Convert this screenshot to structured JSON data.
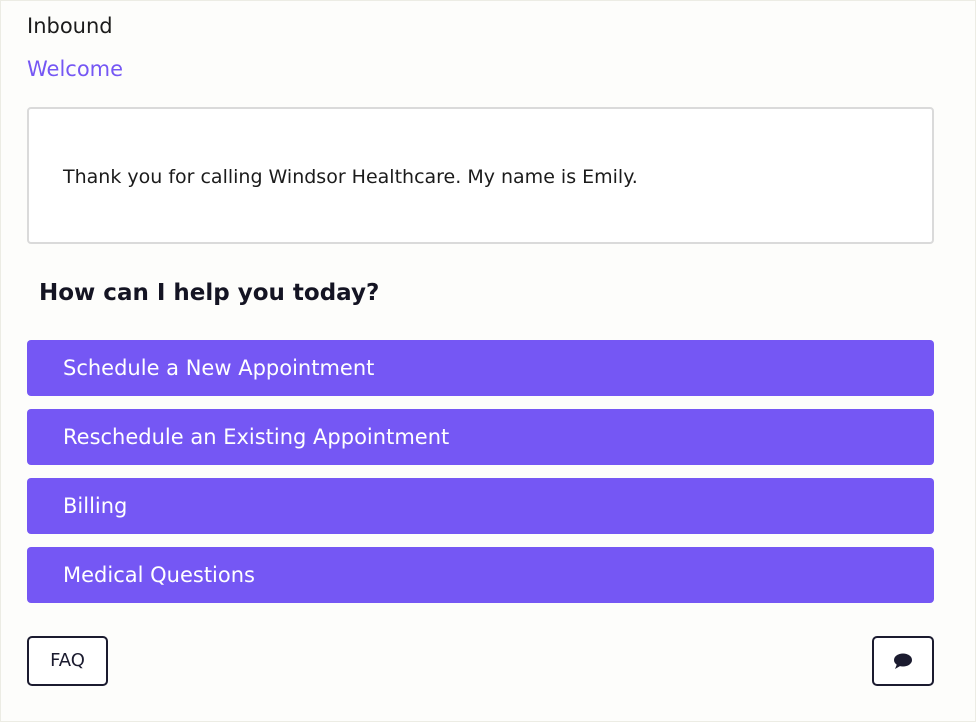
{
  "header": {
    "title": "Inbound"
  },
  "section": {
    "label": "Welcome"
  },
  "greeting": {
    "text": "Thank you for calling Windsor Healthcare. My name is Emily."
  },
  "prompt": {
    "question": "How can I help you today?"
  },
  "options": [
    {
      "label": "Schedule a New Appointment"
    },
    {
      "label": "Reschedule an Existing Appointment"
    },
    {
      "label": "Billing"
    },
    {
      "label": "Medical Questions"
    }
  ],
  "footer": {
    "faq_label": "FAQ",
    "chat_icon": "chat-bubble-icon"
  },
  "colors": {
    "accent": "#7557f4",
    "text_dark": "#1b1b2f",
    "border": "#dadada"
  }
}
